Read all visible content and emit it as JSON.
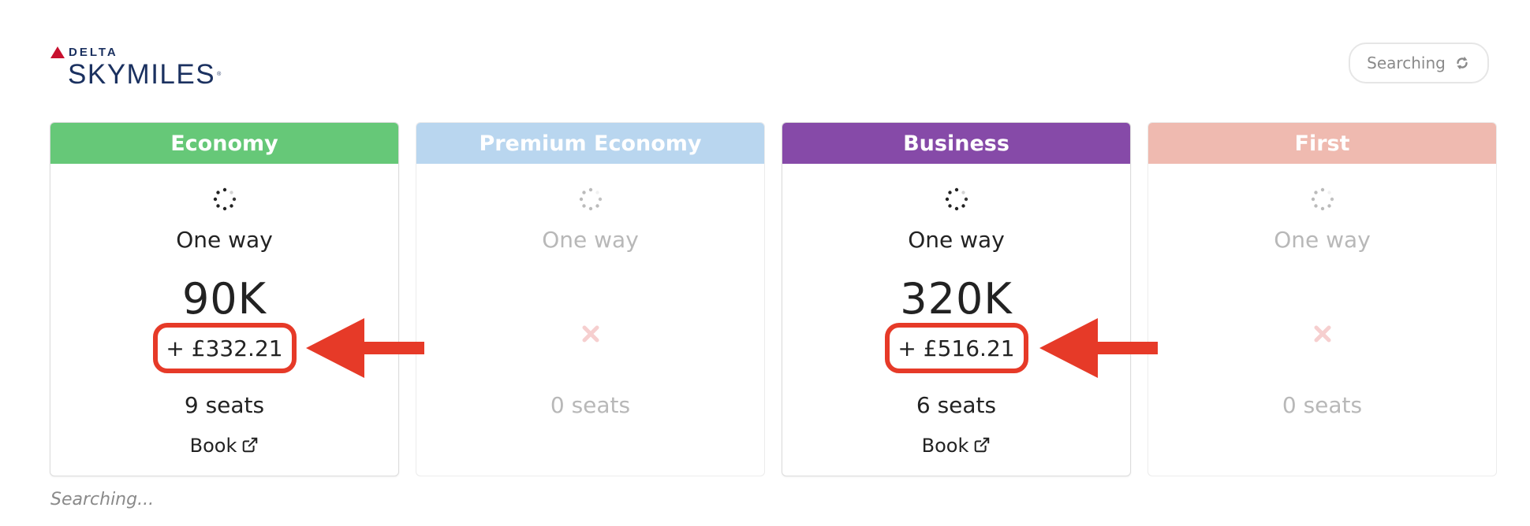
{
  "logo": {
    "brand_top": "DELTA",
    "brand_main": "SKYMILES"
  },
  "status_pill": {
    "label": "Searching"
  },
  "footer": {
    "status": "Searching..."
  },
  "colors": {
    "economy": "#66c878",
    "premium_economy": "#b9d6ef",
    "business": "#864aa8",
    "first": "#efbab0",
    "annotation": "#e63a28"
  },
  "cabins": [
    {
      "name": "Economy",
      "trip": "One way",
      "miles": "90K",
      "taxes": "+ £332.21",
      "seats": "9 seats",
      "book": "Book",
      "available": true
    },
    {
      "name": "Premium Economy",
      "trip": "One way",
      "miles": "",
      "taxes": "",
      "seats": "0 seats",
      "book": "",
      "available": false
    },
    {
      "name": "Business",
      "trip": "One way",
      "miles": "320K",
      "taxes": "+ £516.21",
      "seats": "6 seats",
      "book": "Book",
      "available": true
    },
    {
      "name": "First",
      "trip": "One way",
      "miles": "",
      "taxes": "",
      "seats": "0 seats",
      "book": "",
      "available": false
    }
  ]
}
